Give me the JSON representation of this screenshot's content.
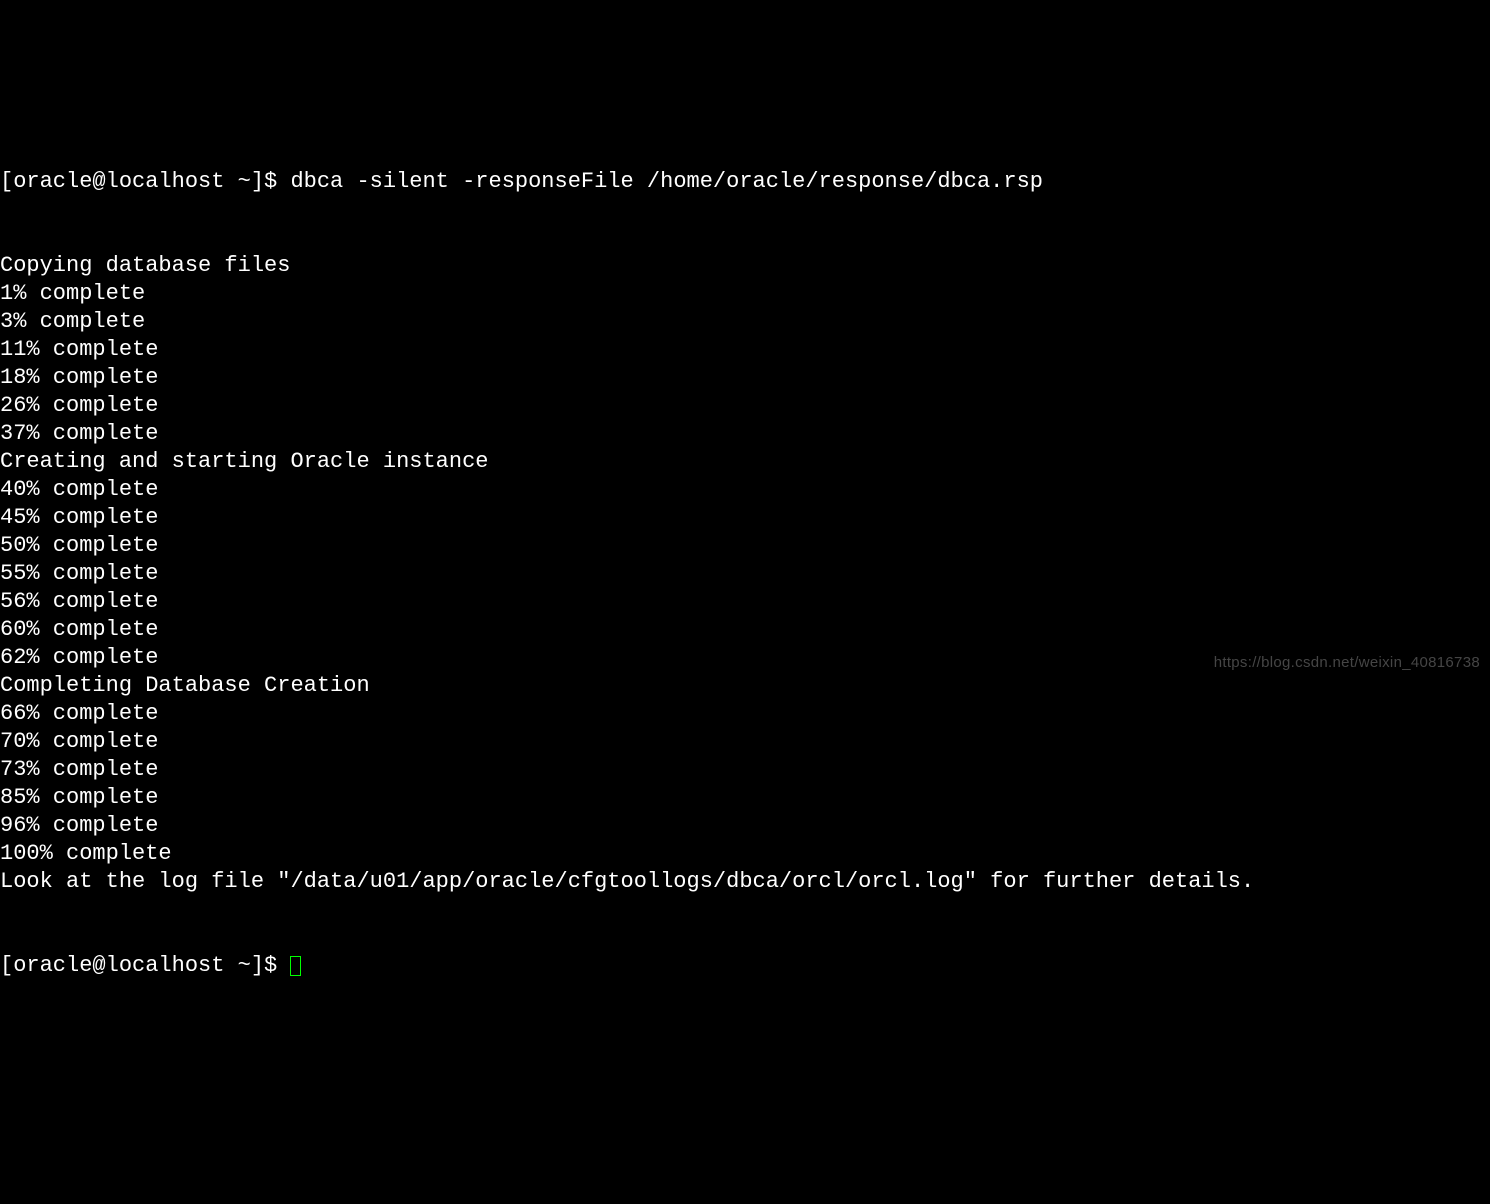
{
  "prompt1": {
    "user_host": "[oracle@localhost ~]",
    "symbol": "$ ",
    "command": "dbca -silent -responseFile /home/oracle/response/dbca.rsp"
  },
  "output_lines": [
    "Copying database files",
    "1% complete",
    "3% complete",
    "11% complete",
    "18% complete",
    "26% complete",
    "37% complete",
    "Creating and starting Oracle instance",
    "40% complete",
    "45% complete",
    "50% complete",
    "55% complete",
    "56% complete",
    "60% complete",
    "62% complete",
    "Completing Database Creation",
    "66% complete",
    "70% complete",
    "73% complete",
    "85% complete",
    "96% complete",
    "100% complete",
    "Look at the log file \"/data/u01/app/oracle/cfgtoollogs/dbca/orcl/orcl.log\" for further details."
  ],
  "prompt2": {
    "user_host": "[oracle@localhost ~]",
    "symbol": "$ "
  },
  "watermark": "https://blog.csdn.net/weixin_40816738"
}
